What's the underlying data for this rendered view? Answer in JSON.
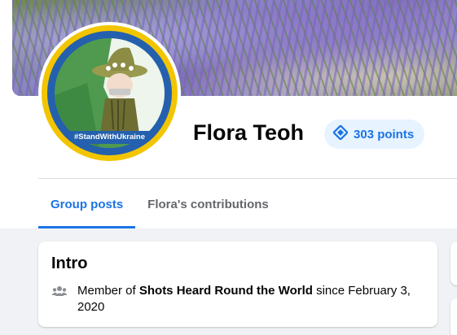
{
  "profile": {
    "name": "Flora Teoh",
    "points_label": "303 points",
    "avatar_badge_text": "#StandWithUkraine"
  },
  "tabs": [
    {
      "label": "Group posts",
      "active": true
    },
    {
      "label": "Flora's contributions",
      "active": false
    }
  ],
  "intro": {
    "title": "Intro",
    "prefix": "Member of ",
    "group_name": "Shots Heard Round the World",
    "suffix": " since February 3, 2020"
  },
  "icons": {
    "points": "diamond-badge-icon",
    "membership": "people-icon"
  },
  "colors": {
    "accent": "#1b74e4",
    "points_bg": "#e7f3ff",
    "avatar_ring_yellow": "#f2c500",
    "avatar_ring_blue": "#2460ad"
  }
}
